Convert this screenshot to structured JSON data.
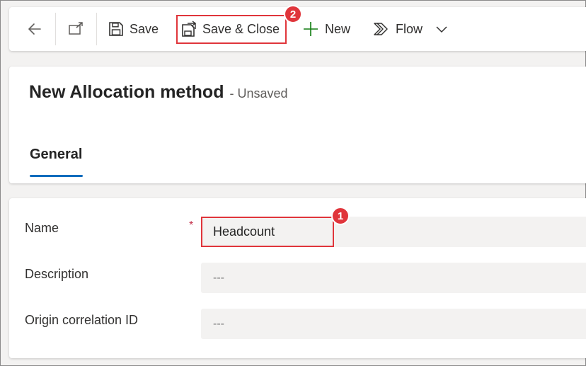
{
  "toolbar": {
    "save_label": "Save",
    "save_close_label": "Save & Close",
    "new_label": "New",
    "flow_label": "Flow"
  },
  "header": {
    "title": "New Allocation method",
    "status": "- Unsaved"
  },
  "tabs": [
    {
      "label": "General",
      "selected": true
    }
  ],
  "form": {
    "fields": [
      {
        "label": "Name",
        "value": "Headcount",
        "required": true
      },
      {
        "label": "Description",
        "value": "---"
      },
      {
        "label": "Origin correlation ID",
        "value": "---"
      }
    ]
  },
  "annotations": [
    {
      "number": "1"
    },
    {
      "number": "2"
    }
  ],
  "colors": {
    "accent": "#0f6cbd",
    "annotation": "#e0353b",
    "new_icon": "#107c10",
    "required": "#c4314b"
  }
}
